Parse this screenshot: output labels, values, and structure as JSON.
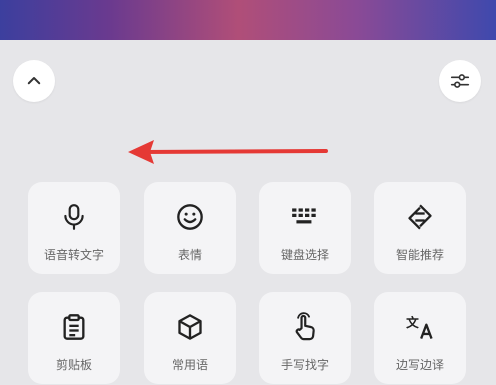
{
  "icons": {
    "collapse": "chevron-up-icon",
    "settings": "sliders-icon",
    "annotation": "red-arrow-left"
  },
  "accent": {
    "arrow": "#e53935"
  },
  "tiles": [
    {
      "label": "语音转文字",
      "icon": "microphone-icon"
    },
    {
      "label": "表情",
      "icon": "smiley-icon"
    },
    {
      "label": "键盘选择",
      "icon": "keyboard-icon"
    },
    {
      "label": "智能推荐",
      "icon": "smart-recommend-icon"
    },
    {
      "label": "剪贴板",
      "icon": "clipboard-icon"
    },
    {
      "label": "常用语",
      "icon": "cube-icon"
    },
    {
      "label": "手写找字",
      "icon": "handwriting-icon"
    },
    {
      "label": "边写边译",
      "icon": "translate-icon"
    }
  ]
}
